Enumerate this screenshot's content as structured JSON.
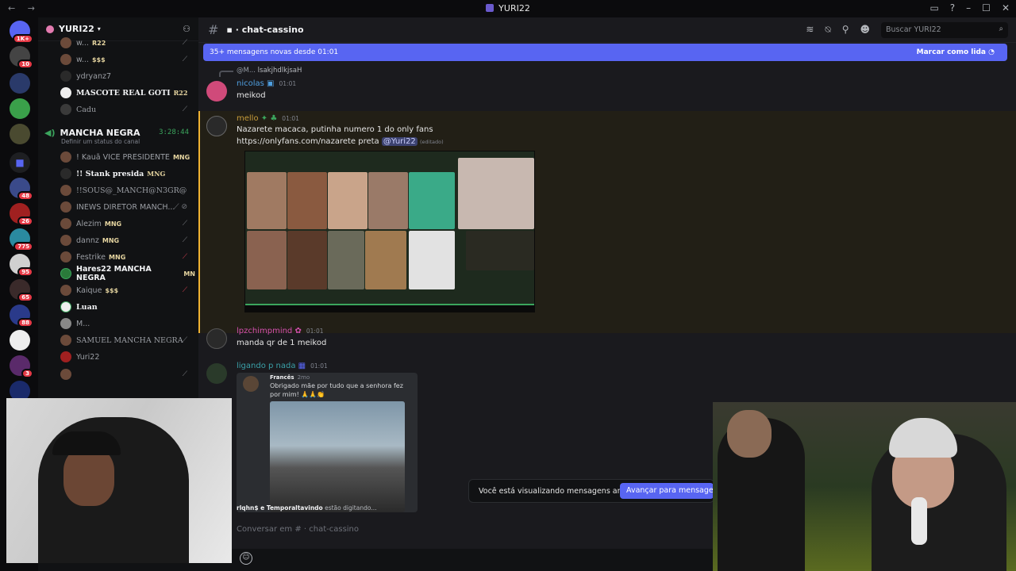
{
  "window": {
    "title": "YURI22",
    "nav": "← →"
  },
  "rail": {
    "badges": [
      "1K+",
      "10",
      "48",
      "26",
      "775",
      "95",
      "65",
      "88",
      "3"
    ]
  },
  "sidebar": {
    "server_name": "YURI22",
    "top_users": [
      {
        "name": "w... ",
        "tag": "R22"
      },
      {
        "name": "w... ",
        "tag": "$$$"
      },
      {
        "name": "ydryanz7",
        "tag": ""
      },
      {
        "name": "MASCOTE REAL GOTI",
        "tag": "R22"
      },
      {
        "name": "Cadu",
        "tag": ""
      }
    ],
    "voice_channel": {
      "name": "MANCHA NEGRA",
      "timer": "3:28:44",
      "status": "Definir um status do canal"
    },
    "members": [
      {
        "name": "! Kauã VICE PRESIDENTE",
        "tag": "MNG"
      },
      {
        "name": "!! Stank presida",
        "tag": "MNG"
      },
      {
        "name": "!!SOUS@_MANCH@N3GR@",
        "tag": ""
      },
      {
        "name": "INEWS DIRETOR MANCH...",
        "tag": ""
      },
      {
        "name": "Alezim",
        "tag": "MNG"
      },
      {
        "name": "dannz",
        "tag": "MNG"
      },
      {
        "name": "Festrike",
        "tag": "MNG"
      },
      {
        "name": "Hares22 MANCHA NEGRA",
        "tag": "MN"
      },
      {
        "name": "Kaique",
        "tag": "$$$"
      },
      {
        "name": "Luan",
        "tag": ""
      },
      {
        "name": "M...",
        "tag": ""
      },
      {
        "name": "SAMUEL MANCHA NEGRA",
        "tag": ""
      },
      {
        "name": "Yuri22",
        "tag": ""
      },
      {
        "name": "",
        "tag": ""
      }
    ]
  },
  "header": {
    "channel_name": "chat-cassino",
    "search_placeholder": "Buscar YURI22"
  },
  "new_messages_bar": {
    "text": "35+ mensagens novas desde 01:01",
    "action": "Marcar como lida"
  },
  "messages": [
    {
      "reply_author": "@M...",
      "reply_text": "lsakjhdlkjsaH",
      "author": "nicolas",
      "time": "01:01",
      "text": "meikod",
      "color": "#4f9fe0"
    },
    {
      "author": "mello",
      "time": "01:01",
      "text": "Nazarete macaca, putinha numero 1 do only fans",
      "link": "https://onlyfans.com/nazarete preta",
      "mention": "@Yuri22",
      "edited": "(editado)",
      "color": "#c79c3a"
    },
    {
      "author": "lpzchimpmind",
      "time": "01:01",
      "text": "manda qr de 1 meikod",
      "color": "#d34fb0"
    },
    {
      "author": "ligando p nada",
      "time": "01:01",
      "color": "#3aa0a8",
      "embed": {
        "author": "Francês",
        "ago": "2mo",
        "text": "Obrigado mãe por tudo que a senhora fez por mim! 🙏🙏👏"
      }
    }
  ],
  "typing": {
    "users": "rlqhn$ e Temporaltavindo",
    "suffix": "estão digitando..."
  },
  "old_messages": {
    "text": "Você está visualizando mensagens antigas",
    "button": "Avançar para mensagens recentes"
  },
  "composer": {
    "placeholder": "Conversar em #  · chat-cassino"
  },
  "colors": {
    "accent": "#5865f2",
    "highlight_border": "#f0b232",
    "online": "#3ba55d"
  }
}
